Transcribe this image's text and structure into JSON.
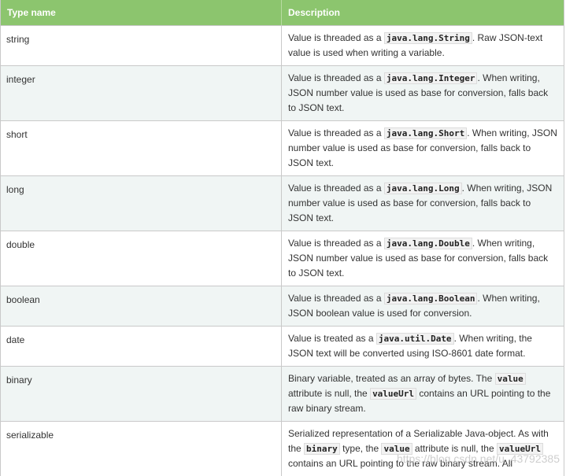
{
  "table": {
    "headers": [
      "Type name",
      "Description"
    ],
    "rows": [
      {
        "type": "string",
        "desc": [
          {
            "t": "Value is threaded as a "
          },
          {
            "code": "java.lang.String"
          },
          {
            "t": ". Raw JSON-text value is used when writing a variable."
          }
        ]
      },
      {
        "type": "integer",
        "desc": [
          {
            "t": "Value is threaded as a "
          },
          {
            "code": "java.lang.Integer"
          },
          {
            "t": ". When writing, JSON number value is used as base for conversion, falls back to JSON text."
          }
        ]
      },
      {
        "type": "short",
        "desc": [
          {
            "t": "Value is threaded as a "
          },
          {
            "code": "java.lang.Short"
          },
          {
            "t": ". When writing, JSON number value is used as base for conversion, falls back to JSON text."
          }
        ]
      },
      {
        "type": "long",
        "desc": [
          {
            "t": "Value is threaded as a "
          },
          {
            "code": "java.lang.Long"
          },
          {
            "t": ". When writing, JSON number value is used as base for conversion, falls back to JSON text."
          }
        ]
      },
      {
        "type": "double",
        "desc": [
          {
            "t": "Value is threaded as a "
          },
          {
            "code": "java.lang.Double"
          },
          {
            "t": ". When writing, JSON number value is used as base for conversion, falls back to JSON text."
          }
        ]
      },
      {
        "type": "boolean",
        "desc": [
          {
            "t": "Value is threaded as a "
          },
          {
            "code": "java.lang.Boolean"
          },
          {
            "t": ". When writing, JSON boolean value is used for conversion."
          }
        ]
      },
      {
        "type": "date",
        "desc": [
          {
            "t": "Value is treated as a "
          },
          {
            "code": "java.util.Date"
          },
          {
            "t": ". When writing, the JSON text will be converted using ISO-8601 date format."
          }
        ]
      },
      {
        "type": "binary",
        "desc": [
          {
            "t": "Binary variable, treated as an array of bytes. The "
          },
          {
            "code": "value"
          },
          {
            "t": " attribute is null, the "
          },
          {
            "code": "valueUrl"
          },
          {
            "t": " contains an URL pointing to the raw binary stream."
          }
        ]
      },
      {
        "type": "serializable",
        "desc": [
          {
            "t": "Serialized representation of a Serializable Java-object. As with the "
          },
          {
            "code": "binary"
          },
          {
            "t": " type, the "
          },
          {
            "code": "value"
          },
          {
            "t": " attribute is null, the "
          },
          {
            "code": "valueUrl"
          },
          {
            "t": " contains an URL pointing to the raw binary stream. All"
          }
        ]
      }
    ]
  },
  "watermark": "https://blog.csdn.net/u_43792385"
}
